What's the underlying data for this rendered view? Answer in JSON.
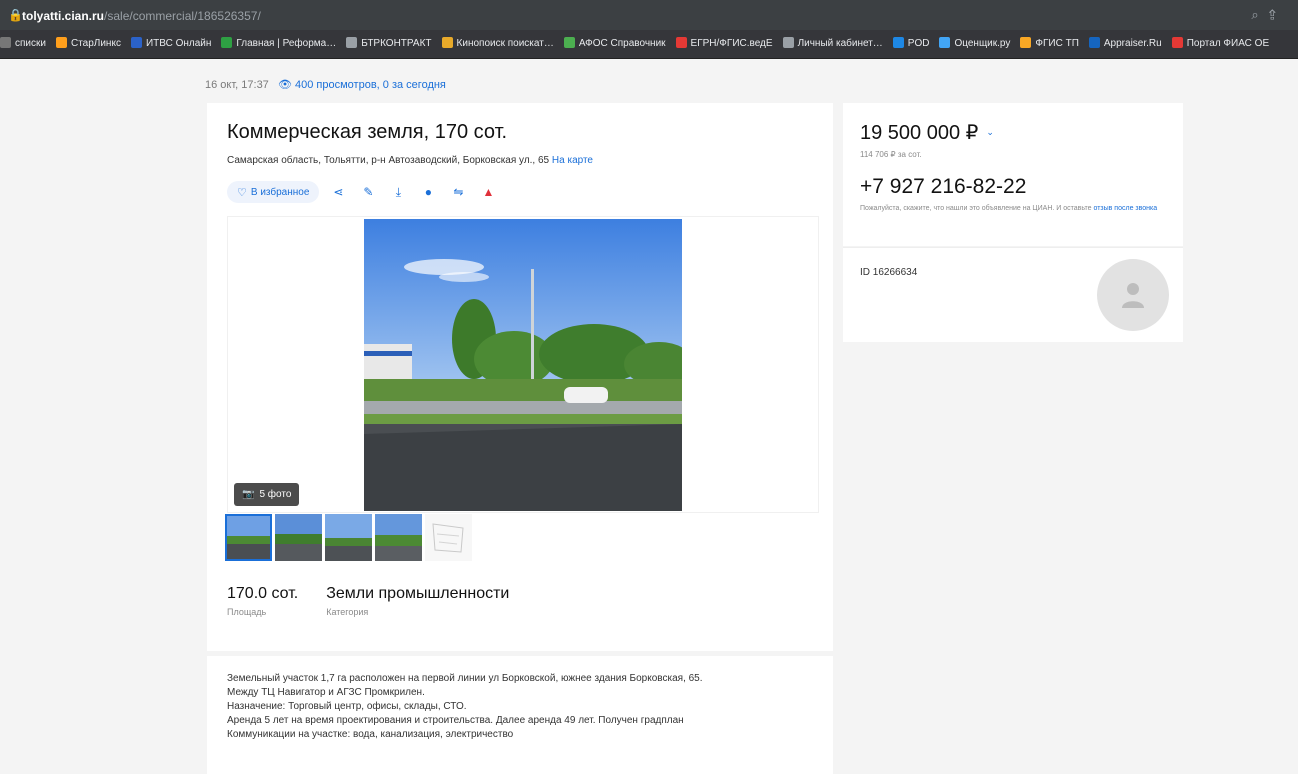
{
  "browser": {
    "url_host": "tolyatti.cian.ru",
    "url_path": "/sale/commercial/186526357/",
    "bookmarks": [
      {
        "label": "списки",
        "color": "#777777"
      },
      {
        "label": "СтарЛинкс",
        "color": "#ff9f1c"
      },
      {
        "label": "ИТВС Онлайн",
        "color": "#2b62c9"
      },
      {
        "label": "Главная | Реформа…",
        "color": "#2ea043"
      },
      {
        "label": "БТРКОНТРАКТ",
        "color": "#9aa0a6"
      },
      {
        "label": "Кинопоиск поискат…",
        "color": "#e8aa2a"
      },
      {
        "label": "АФОС Справочник",
        "color": "#4caf50"
      },
      {
        "label": "ЕГРН/ФГИС.ведЕ",
        "color": "#e53935"
      },
      {
        "label": "Личный кабинет…",
        "color": "#9aa0a6"
      },
      {
        "label": "POD",
        "color": "#1e88e5"
      },
      {
        "label": "Оценщик.ру",
        "color": "#42a5f5"
      },
      {
        "label": "ФГИС ТП",
        "color": "#f9a825"
      },
      {
        "label": "Appraiser.Ru",
        "color": "#1565c0"
      },
      {
        "label": "Портал ФИАС ОЕ",
        "color": "#e53935"
      }
    ]
  },
  "meta": {
    "date": "16 окт, 17:37",
    "views": "400 просмотров, 0 за сегодня"
  },
  "listing": {
    "title": "Коммерческая земля, 170 сот.",
    "address": "Самарская область, Тольятти, р-н Автозаводский, Борковская ул., 65",
    "map_link": "На карте",
    "favorite_label": "В избранное",
    "photo_count": "5 фото",
    "area_value": "170.0 сот.",
    "area_label": "Площадь",
    "category_value": "Земли промышленности",
    "category_label": "Категория",
    "description": "Земельный участок 1,7 га расположен на первой линии ул Борковской, южнее здания Борковская, 65.\nМежду ТЦ Навигатор и АГЗС Промкрилен.\nНазначение: Торговый центр, офисы, склады, СТО.\nАренда 5 лет на время проектирования и строительства. Далее аренда 49 лет.  Получен градплан\nКоммуникации на участке: вода, канализация, электричество"
  },
  "sidebar": {
    "price": "19 500 000 ₽",
    "price_per": "114 706 ₽ за сот.",
    "phone": "+7 927 216-82-22",
    "note_text": "Пожалуйста, скажите, что нашли это объявление на ЦИАН. И оставьте",
    "note_link": "отзыв после звонка",
    "id_text": "ID 16266634"
  },
  "colors": {
    "accent": "#1a6fd8",
    "danger": "#e0303a"
  }
}
